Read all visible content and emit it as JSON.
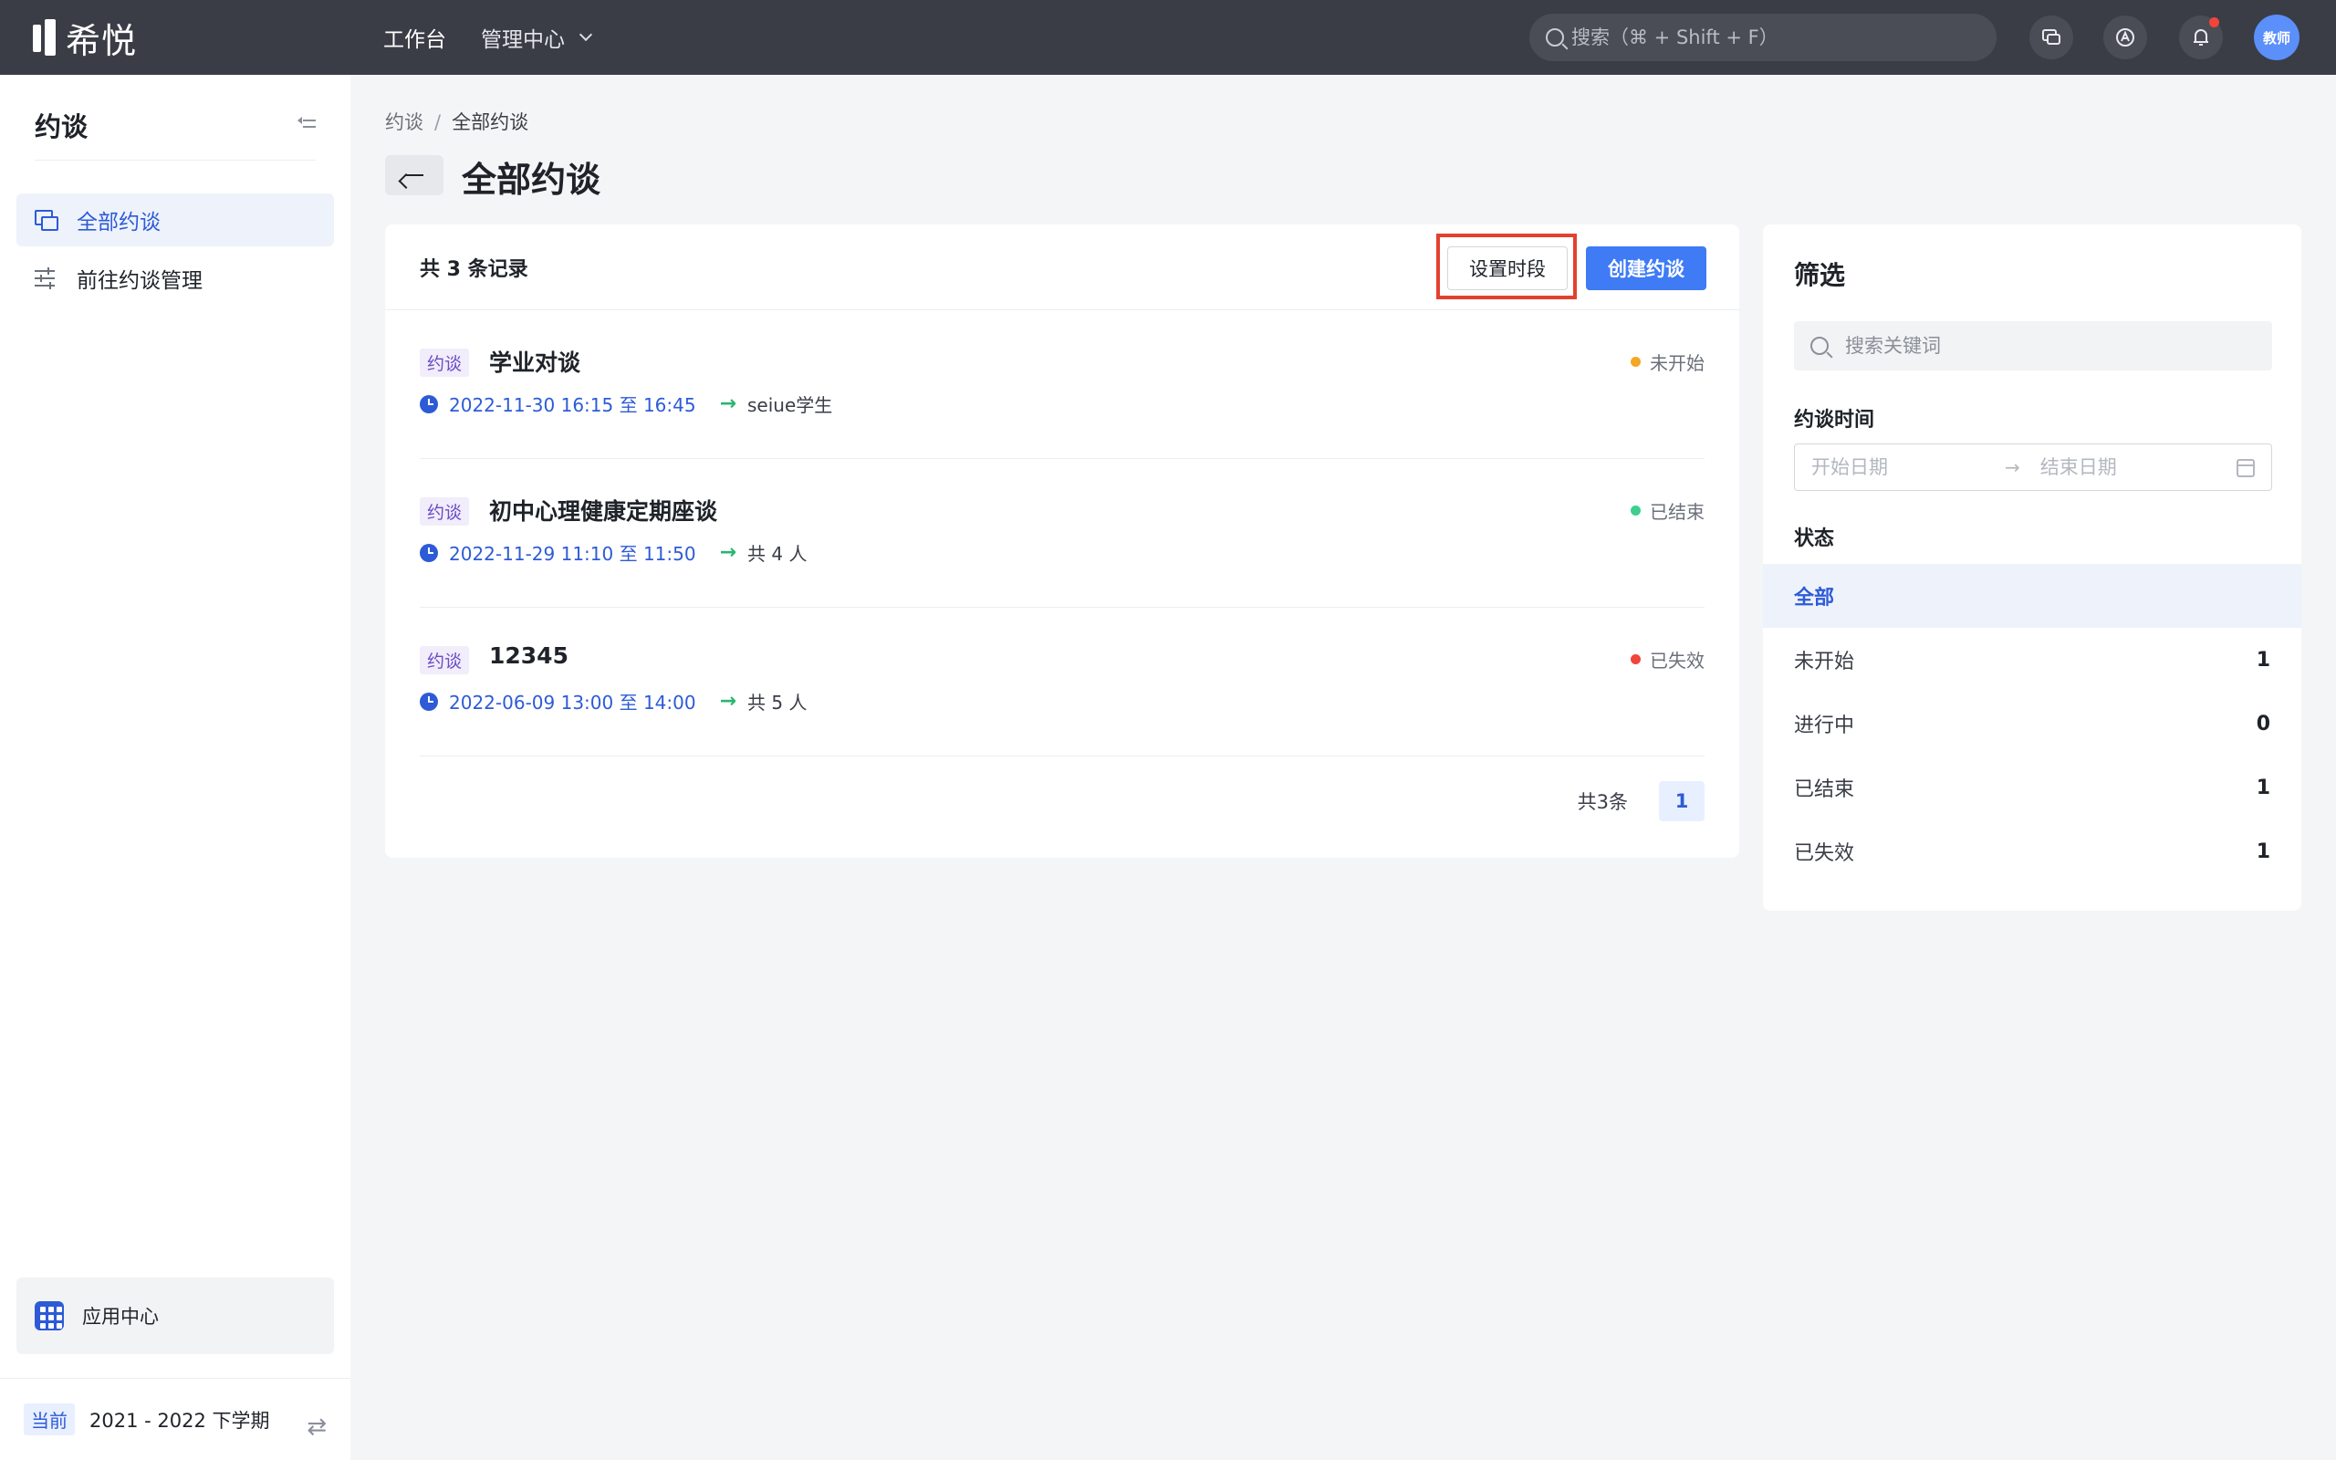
{
  "topbar": {
    "brand": "希悦",
    "nav": [
      {
        "label": "工作台"
      },
      {
        "label": "管理中心"
      }
    ],
    "search_placeholder": "搜索（⌘ + Shift + F）",
    "avatar_text": "教师"
  },
  "sidebar": {
    "title": "约谈",
    "items": [
      {
        "label": "全部约谈",
        "active": true
      },
      {
        "label": "前往约谈管理",
        "active": false
      }
    ],
    "app_center_label": "应用中心",
    "term_tag": "当前",
    "term_label": "2021 - 2022 下学期"
  },
  "breadcrumb": {
    "root": "约谈",
    "separator": "/",
    "current": "全部约谈"
  },
  "page": {
    "title": "全部约谈"
  },
  "list": {
    "count_label": "共 3 条记录",
    "set_slot_label": "设置时段",
    "create_label": "创建约谈",
    "rows": [
      {
        "tag": "约谈",
        "title": "学业对谈",
        "time": "2022-11-30 16:15 至 16:45",
        "target": "seiue学生",
        "status": "未开始",
        "status_color": "#f5a623"
      },
      {
        "tag": "约谈",
        "title": "初中心理健康定期座谈",
        "time": "2022-11-29 11:10 至 11:50",
        "target": "共 4 人",
        "status": "已结束",
        "status_color": "#3ccf8e"
      },
      {
        "tag": "约谈",
        "title": "12345",
        "time": "2022-06-09 13:00 至 14:00",
        "target": "共 5 人",
        "status": "已失效",
        "status_color": "#f0453a"
      }
    ],
    "pager_total": "共3条",
    "pager_current": "1"
  },
  "filter": {
    "title": "筛选",
    "keyword_placeholder": "搜索关键词",
    "time_label": "约谈时间",
    "start_placeholder": "开始日期",
    "range_arrow": "→",
    "end_placeholder": "结束日期",
    "status_label": "状态",
    "statuses": [
      {
        "label": "全部",
        "count": "",
        "active": true
      },
      {
        "label": "未开始",
        "count": "1",
        "active": false
      },
      {
        "label": "进行中",
        "count": "0",
        "active": false
      },
      {
        "label": "已结束",
        "count": "1",
        "active": false
      },
      {
        "label": "已失效",
        "count": "1",
        "active": false
      }
    ]
  },
  "colors": {
    "topbar": "#3a3d46",
    "primary": "#3e7bf5",
    "highlight": "#e3412f"
  }
}
